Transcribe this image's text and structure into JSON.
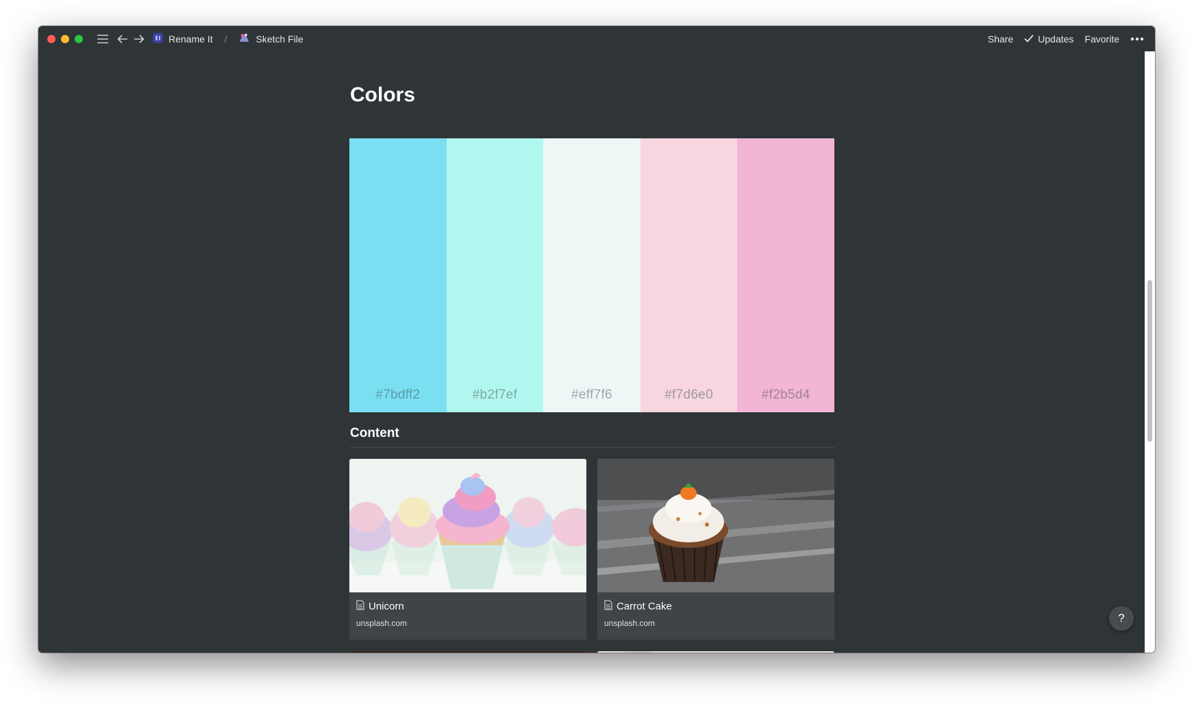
{
  "breadcrumb": [
    {
      "label": "Rename It",
      "icon": "rename-it-app-icon"
    },
    {
      "label": "Sketch File",
      "icon": "sketch-file-icon"
    }
  ],
  "breadcrumb_separator": "/",
  "toolbar": {
    "share": "Share",
    "updates": "Updates",
    "favorite": "Favorite"
  },
  "page_title": "Colors",
  "palette": [
    {
      "hex": "#7bdff2"
    },
    {
      "hex": "#b2f7ef"
    },
    {
      "hex": "#eff7f6"
    },
    {
      "hex": "#f7d6e0"
    },
    {
      "hex": "#f2b5d4"
    }
  ],
  "content_section": {
    "title": "Content",
    "cards": [
      {
        "title": "Unicorn",
        "source": "unsplash.com"
      },
      {
        "title": "Carrot Cake",
        "source": "unsplash.com"
      }
    ]
  },
  "help_label": "?",
  "colors": {
    "window_bg": "#2f3437",
    "card_bg": "#3f4447"
  }
}
